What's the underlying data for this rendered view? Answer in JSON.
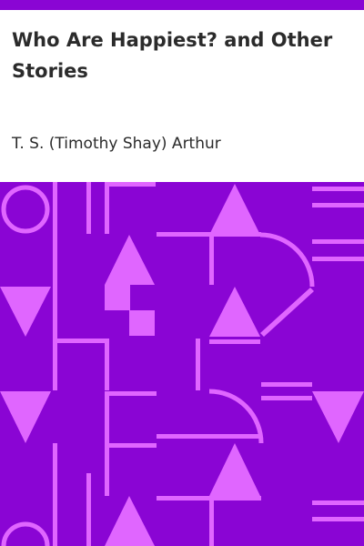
{
  "book": {
    "title": "Who Are Happiest? and Other Stories",
    "author": "T. S. (Timothy Shay) Arthur"
  },
  "colors": {
    "background": "#ffffff",
    "accent": "#8a05d4",
    "pattern_fill": "#8a05d4",
    "pattern_shapes": "#e066ff",
    "text": "#2b2b2b"
  }
}
